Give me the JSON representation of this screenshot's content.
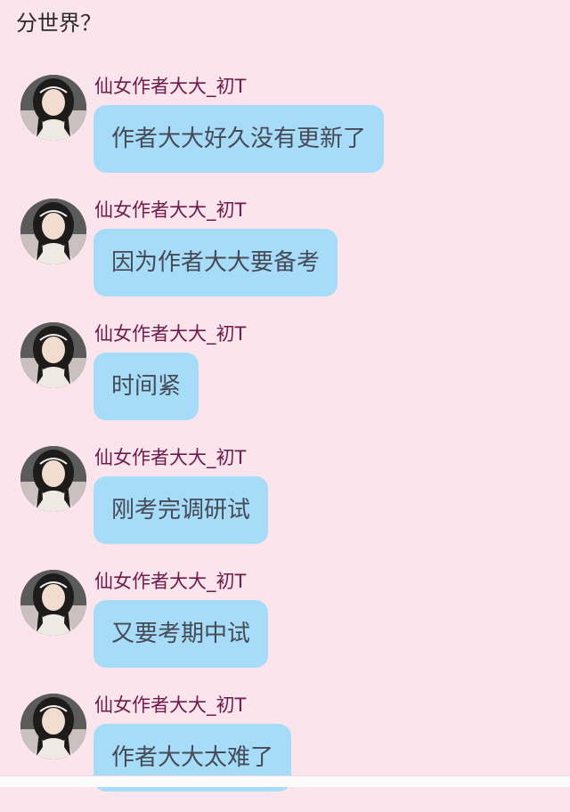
{
  "top_text": "分世界？",
  "messages": [
    {
      "sender": "仙女作者大大_初T",
      "text": "作者大大好久没有更新了",
      "avatar_icon": "user-avatar-icon"
    },
    {
      "sender": "仙女作者大大_初T",
      "text": "因为作者大大要备考",
      "avatar_icon": "user-avatar-icon"
    },
    {
      "sender": "仙女作者大大_初T",
      "text": "时间紧",
      "avatar_icon": "user-avatar-icon"
    },
    {
      "sender": "仙女作者大大_初T",
      "text": "刚考完调研试",
      "avatar_icon": "user-avatar-icon"
    },
    {
      "sender": "仙女作者大大_初T",
      "text": "又要考期中试",
      "avatar_icon": "user-avatar-icon"
    },
    {
      "sender": "仙女作者大大_初T",
      "text": "作者大大太难了",
      "avatar_icon": "user-avatar-icon"
    }
  ],
  "colors": {
    "background": "#fce4ec",
    "bubble": "#a7dcf8",
    "sender_name": "#6e1b4a",
    "message_text": "#454a57"
  }
}
